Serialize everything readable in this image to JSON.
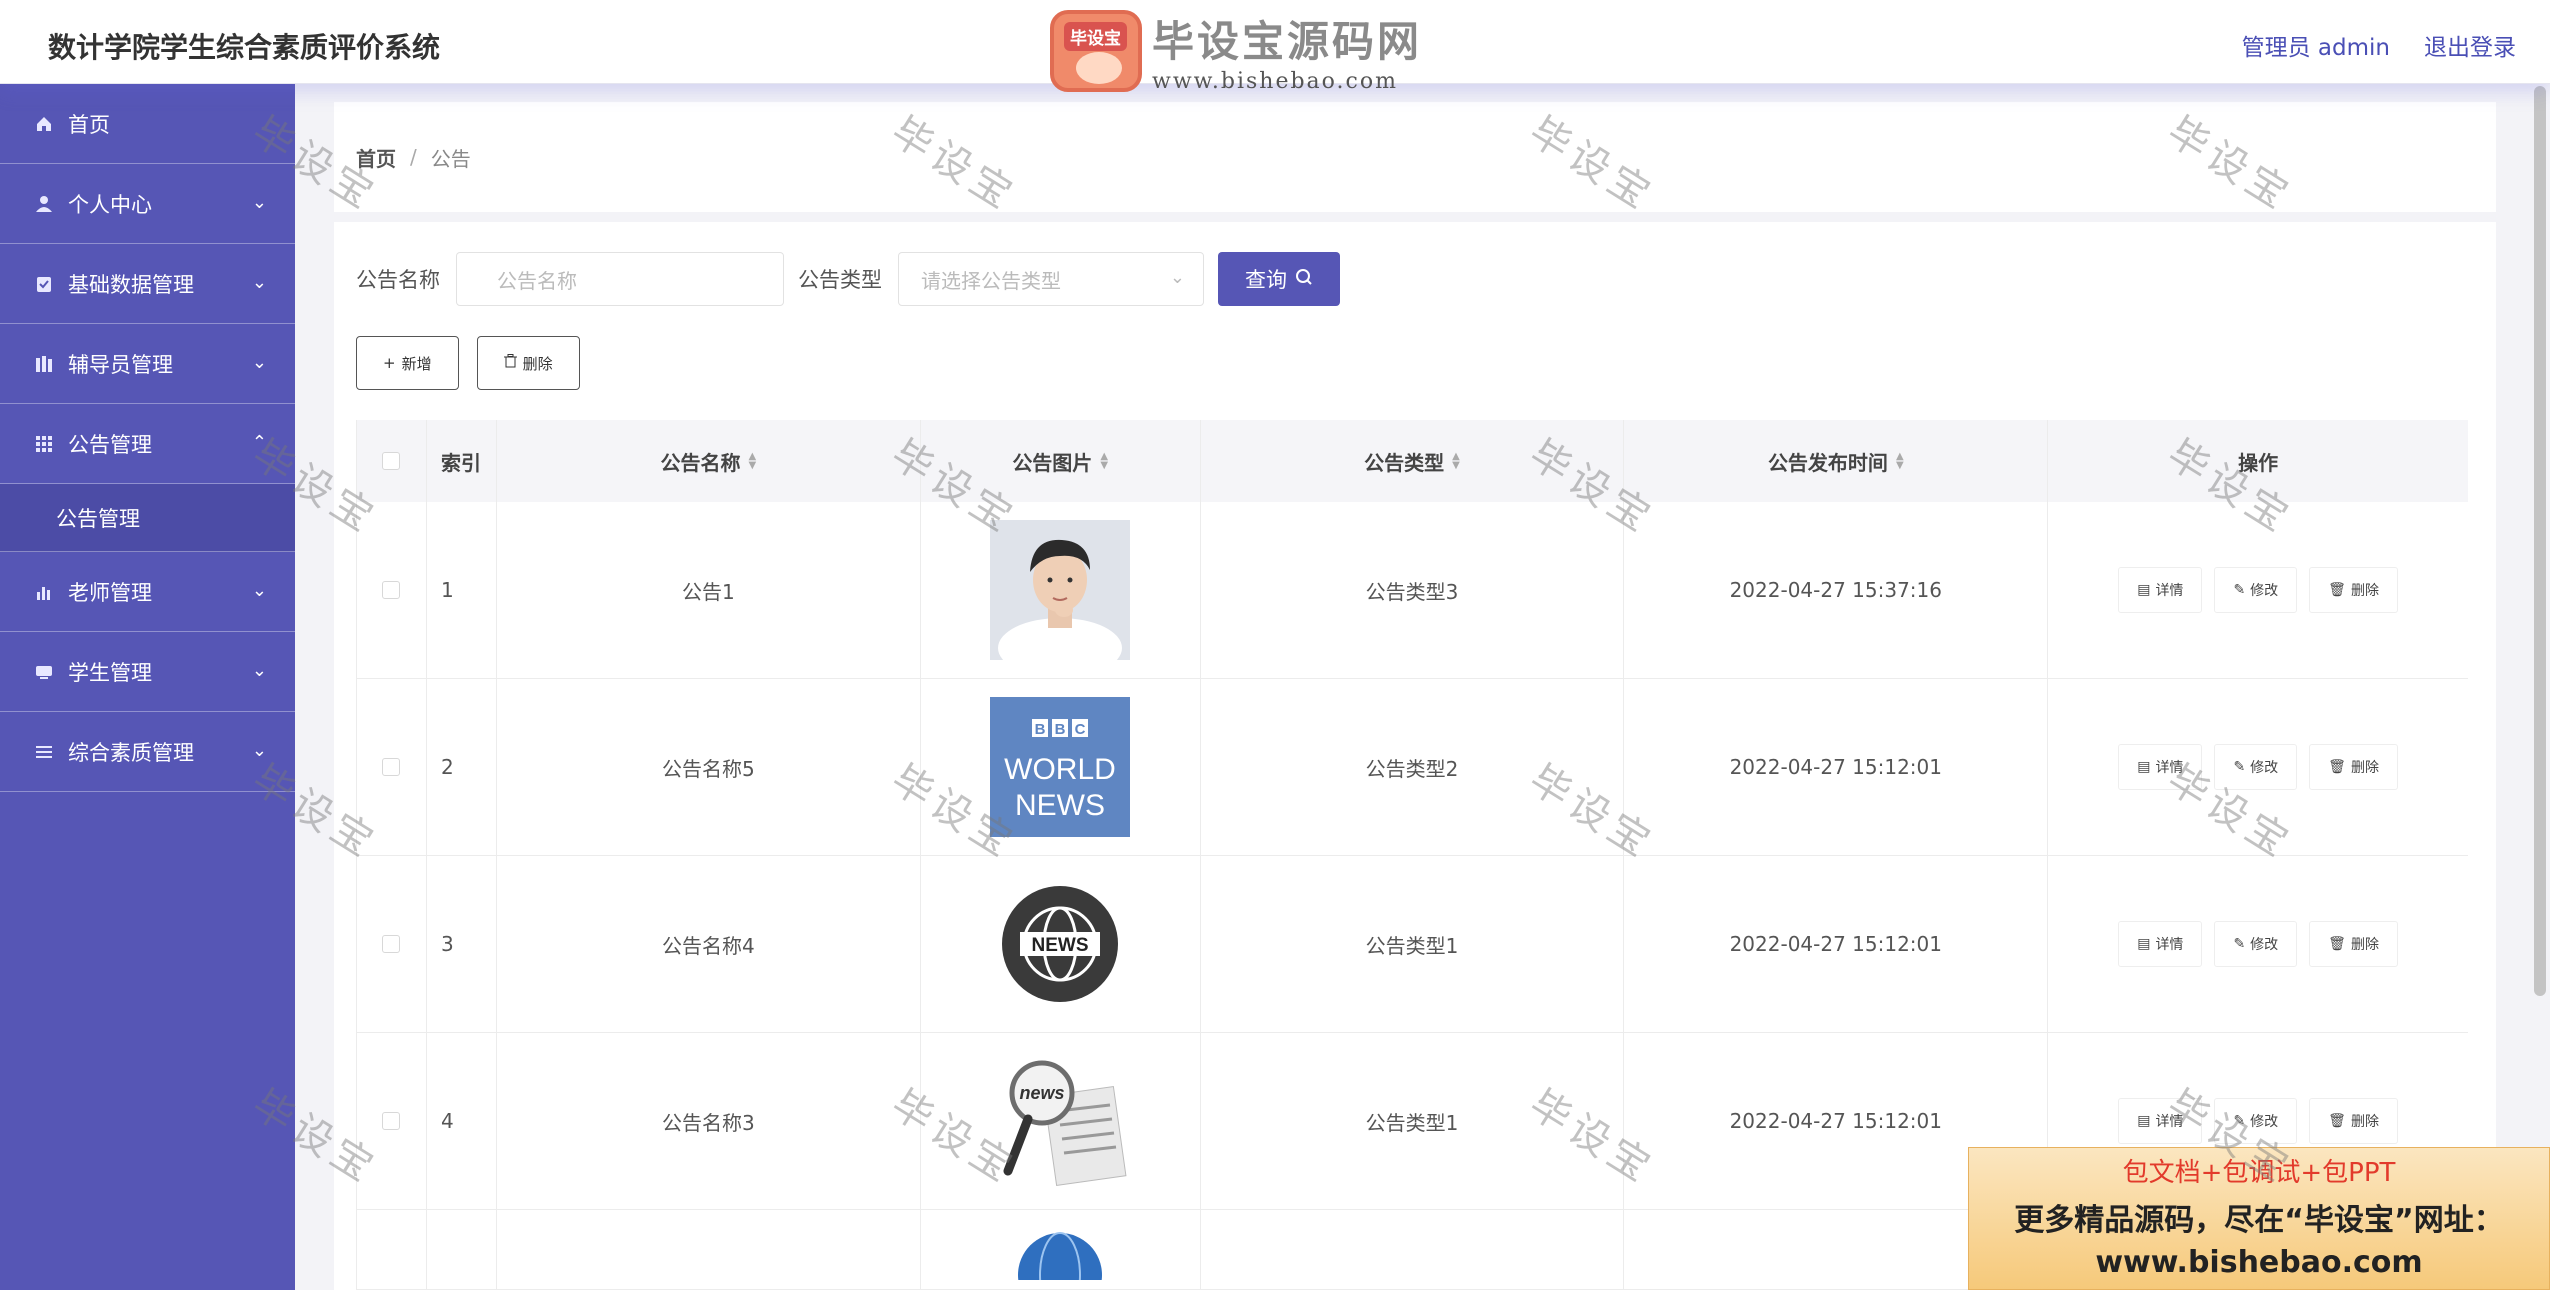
{
  "header": {
    "app_title": "数计学院学生综合素质评价系统",
    "user_label": "管理员 admin",
    "logout_label": "退出登录"
  },
  "logo": {
    "badge_text": "毕设宝",
    "brand_text": "毕设宝源码网",
    "url_text": "www.bishebao.com"
  },
  "sidebar": {
    "items": [
      {
        "label": "首页",
        "icon": "home-icon",
        "expandable": false
      },
      {
        "label": "个人中心",
        "icon": "user-icon",
        "expandable": true
      },
      {
        "label": "基础数据管理",
        "icon": "clipboard-icon",
        "expandable": true
      },
      {
        "label": "辅导员管理",
        "icon": "books-icon",
        "expandable": true
      },
      {
        "label": "公告管理",
        "icon": "grid-icon",
        "expandable": true,
        "expanded": true
      },
      {
        "label": "老师管理",
        "icon": "bar-chart-icon",
        "expandable": true
      },
      {
        "label": "学生管理",
        "icon": "card-icon",
        "expandable": true
      },
      {
        "label": "综合素质管理",
        "icon": "list-icon",
        "expandable": true
      }
    ],
    "submenu": {
      "label": "公告管理"
    }
  },
  "breadcrumb": {
    "home": "首页",
    "separator": "/",
    "current": "公告"
  },
  "filters": {
    "name_label": "公告名称",
    "name_placeholder": "公告名称",
    "type_label": "公告类型",
    "type_placeholder": "请选择公告类型",
    "query_label": "查询"
  },
  "actions": {
    "add_label": "新增",
    "delete_label": "删除"
  },
  "table": {
    "headers": {
      "index": "索引",
      "name": "公告名称",
      "image": "公告图片",
      "type": "公告类型",
      "time": "公告发布时间",
      "ops": "操作"
    },
    "row_ops": {
      "detail": "详情",
      "edit": "修改",
      "delete": "删除"
    },
    "rows": [
      {
        "index": "1",
        "name": "公告1",
        "image": "portrait",
        "type": "公告类型3",
        "time": "2022-04-27 15:37:16"
      },
      {
        "index": "2",
        "name": "公告名称5",
        "image": "bbc-world-news",
        "type": "公告类型2",
        "time": "2022-04-27 15:12:01"
      },
      {
        "index": "3",
        "name": "公告名称4",
        "image": "globe-news",
        "type": "公告类型1",
        "time": "2022-04-27 15:12:01"
      },
      {
        "index": "4",
        "name": "公告名称3",
        "image": "magnifier-news",
        "type": "公告类型1",
        "time": "2022-04-27 15:12:01"
      }
    ]
  },
  "thumb_texts": {
    "bbc_letters": [
      "B",
      "B",
      "C"
    ],
    "bbc_line1": "WORLD",
    "bbc_line2": "NEWS",
    "globe_label": "NEWS",
    "magnifier_label": "news"
  },
  "ad": {
    "line1": "包文档+包调试+包PPT",
    "line2": "更多精品源码，尽在“毕设宝”网址：",
    "line3": "www.bishebao.com"
  },
  "watermark": "毕设宝",
  "colors": {
    "primary": "#5656b5",
    "sidebar_sub": "#4c4ca6",
    "ad_text_red": "#e23a2b"
  }
}
